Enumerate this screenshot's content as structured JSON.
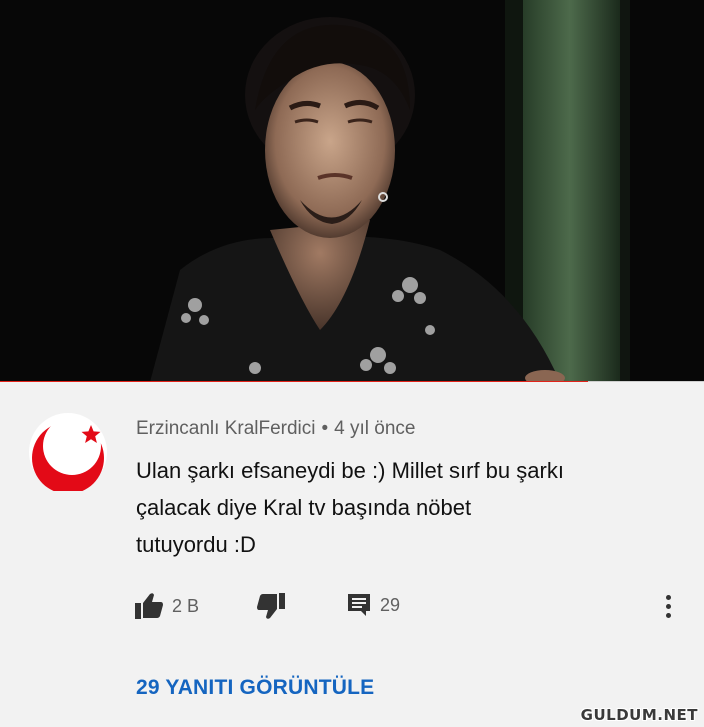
{
  "video": {
    "progress_fraction": 0.835
  },
  "comment": {
    "author": "Erzincanlı KralFerdici",
    "separator": "•",
    "time": "4 yıl önce",
    "text_lines": [
      "Ulan şarkı efsaneydi be :) Millet sırf bu şarkı",
      "çalacak diye Kral tv başında nöbet",
      "tutuyordu :D"
    ],
    "likes": "2 B",
    "replies_count": "29",
    "view_replies_label": "29 YANITI GÖRÜNTÜLE",
    "avatar_icon": "crescent-star-logo-icon"
  },
  "watermark": "GULDUM.NET",
  "colors": {
    "accent_red": "#e2231a",
    "link_blue": "#1565c0",
    "background": "#f2f2f2"
  }
}
